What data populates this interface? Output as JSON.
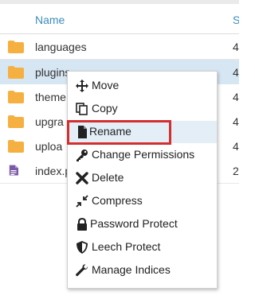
{
  "table": {
    "header": {
      "name_label": "Name",
      "size_label": "S"
    },
    "rows": [
      {
        "name": "languages",
        "size": "4",
        "type": "folder"
      },
      {
        "name": "plugins",
        "size": "4",
        "type": "folder",
        "selected": true
      },
      {
        "name": "theme",
        "size": "4",
        "type": "folder"
      },
      {
        "name": "upgra",
        "size": "4",
        "type": "folder"
      },
      {
        "name": "uploa",
        "size": "4",
        "type": "folder"
      },
      {
        "name": "index.p",
        "size": "2",
        "type": "file"
      }
    ]
  },
  "context_menu": {
    "items": [
      {
        "label": "Move",
        "icon": "move-icon"
      },
      {
        "label": "Copy",
        "icon": "copy-icon"
      },
      {
        "label": "Rename",
        "icon": "file-icon",
        "highlighted": true
      },
      {
        "label": "Change Permissions",
        "icon": "key-icon"
      },
      {
        "label": "Delete",
        "icon": "x-icon"
      },
      {
        "label": "Compress",
        "icon": "compress-icon"
      },
      {
        "label": "Password Protect",
        "icon": "lock-icon"
      },
      {
        "label": "Leech Protect",
        "icon": "shield-icon"
      },
      {
        "label": "Manage Indices",
        "icon": "wrench-icon"
      }
    ]
  },
  "colors": {
    "folder": "#f5b041",
    "php_file": "#7a5aa6",
    "header_text": "#3c8dbc",
    "selected_row": "#d6e6f3",
    "annotation_red": "#d32f2f"
  }
}
